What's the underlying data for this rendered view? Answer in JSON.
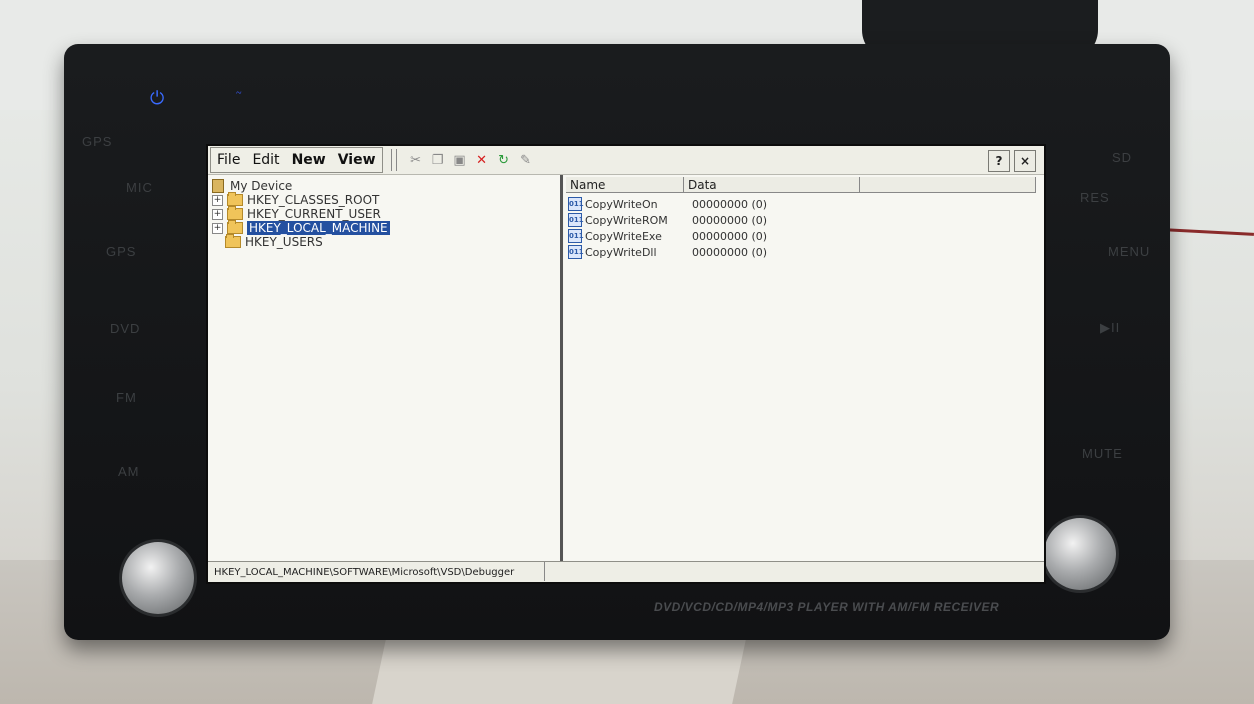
{
  "device": {
    "side_left": [
      "GPS",
      "MIC",
      "GPS",
      "DVD",
      "FM",
      "AM"
    ],
    "side_right": [
      "SD",
      "RES",
      "MENU",
      "▶II",
      "",
      "MUTE"
    ],
    "tagline": "DVD/VCD/CD/MP4/MP3 PLAYER WITH AM/FM RECEIVER"
  },
  "menu": [
    {
      "label": "File",
      "bold": false
    },
    {
      "label": "Edit",
      "bold": false
    },
    {
      "label": "New",
      "bold": true
    },
    {
      "label": "View",
      "bold": true
    }
  ],
  "toolbar": {
    "tools": [
      "cut-icon",
      "copy-icon",
      "paste-icon",
      "delete-icon",
      "refresh-icon",
      "properties-icon"
    ],
    "help_label": "?",
    "close_label": "×"
  },
  "tree": {
    "root": "My Device",
    "items": [
      {
        "label": "HKEY_CLASSES_ROOT",
        "expandable": true,
        "selected": false
      },
      {
        "label": "HKEY_CURRENT_USER",
        "expandable": true,
        "selected": false
      },
      {
        "label": "HKEY_LOCAL_MACHINE",
        "expandable": true,
        "selected": true
      },
      {
        "label": "HKEY_USERS",
        "expandable": false,
        "selected": false
      }
    ]
  },
  "list": {
    "columns": [
      "Name",
      "Data"
    ],
    "rows": [
      {
        "name": "CopyWriteOn",
        "data": "00000000 (0)"
      },
      {
        "name": "CopyWriteROM",
        "data": "00000000 (0)"
      },
      {
        "name": "CopyWriteExe",
        "data": "00000000 (0)"
      },
      {
        "name": "CopyWriteDll",
        "data": "00000000 (0)"
      }
    ]
  },
  "status": "HKEY_LOCAL_MACHINE\\SOFTWARE\\Microsoft\\VSD\\Debugger",
  "colors": {
    "selection": "#2450a0",
    "led": "#3a6bff"
  }
}
